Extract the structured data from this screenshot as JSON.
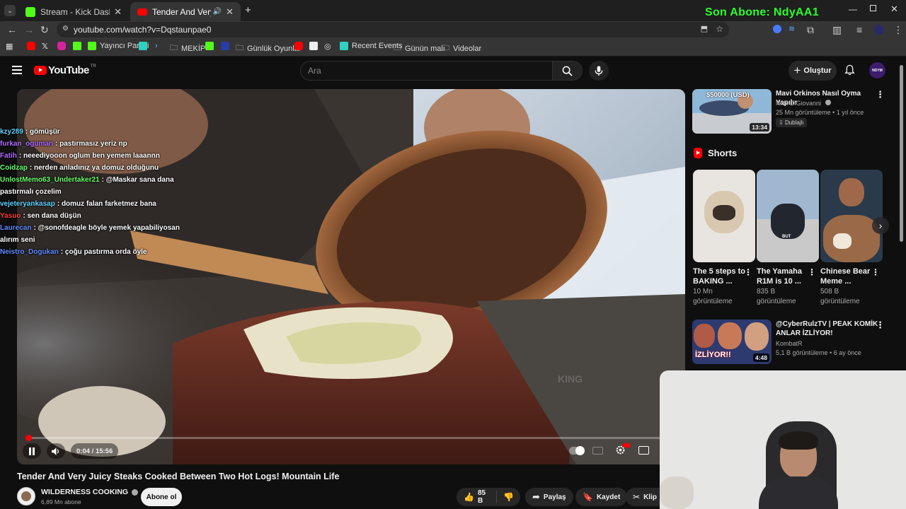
{
  "browser": {
    "tabs": [
      {
        "label": "Stream - Kick Dashboard",
        "active": false
      },
      {
        "label": "Tender And Very Juicy Steak",
        "active": true
      }
    ],
    "url": "youtube.com/watch?v=Dqstaunpae0",
    "overlay_text": "Son Abone: NdyAA1",
    "bookmarks": [
      "Yayıncı Paneli",
      "MEKİP",
      "Günlük Oyunlar",
      "Recent Events",
      "Günün malı",
      "Videolar"
    ]
  },
  "youtube": {
    "logo_text": "YouTube",
    "logo_region": "TR",
    "search_placeholder": "Ara",
    "create_label": "Oluştur",
    "avatar_text": "NDYM"
  },
  "player": {
    "time_current": "0:04",
    "time_total": "15:56",
    "progress": 0.004,
    "watermark": "KING"
  },
  "chat": [
    {
      "user": "kzy289",
      "text": ": gömüşür",
      "color": "#5fd3ff"
    },
    {
      "user": "furkan_oguman",
      "text": ": pastırmasız yeriz np",
      "color": "#b26bff"
    },
    {
      "user": "Fatih",
      "text": ": neeediyooon oglum ben yemem laaannn",
      "color": "#b26bff"
    },
    {
      "user": "Coidzap",
      "text": ": nerden anladınız ya domuz olduğunu",
      "color": "#66ff66"
    },
    {
      "user": "UnlostMemo63_Undertaker21",
      "text": ": @Maskar sana dana pastırmalı çozelim",
      "color": "#66ff66"
    },
    {
      "user": "vejeteryankasap",
      "text": ": domuz falan farketmez bana",
      "color": "#5fd3ff"
    },
    {
      "user": "Yasuo",
      "text": ": sen dana düşün",
      "color": "#ff3b3b"
    },
    {
      "user": "Laurecan",
      "text": ": @sonofdeagle böyle yemek yapabiliyosan alırım seni",
      "color": "#5f8cff"
    },
    {
      "user": "Neistro_Dogukan",
      "text": ": çoğu pastırma orda öyle",
      "color": "#5f8cff"
    }
  ],
  "video": {
    "title": "Tender And Very Juicy Steaks Cooked Between Two Hot Logs! Mountain Life",
    "channel": "WILDERNESS COOKING",
    "subscribers": "6,89 Mn abone",
    "subscribe_label": "Abone ol",
    "likes": "85 B",
    "share_label": "Paylaş",
    "save_label": "Kaydet",
    "clip_label": "Klip"
  },
  "sidebar": {
    "rec1": {
      "title": "Mavi Orkinos Nasıl Oyma Yapılır",
      "channel": "Nick DiGiovanni",
      "meta": "25 Mn görüntüleme • 1 yıl önce",
      "badge": "Dublajlı",
      "duration": "13:34",
      "thumb_text": "$50000 (USD)"
    },
    "shorts_heading": "Shorts",
    "shorts": [
      {
        "title": "The 5 steps to BAKING ...",
        "views": "10 Mn",
        "views2": "görüntüleme"
      },
      {
        "title": "The Yamaha R1M is 10 ...",
        "views": "835 B",
        "views2": "görüntüleme"
      },
      {
        "title": "Chinese Bear Meme ...",
        "views": "508 B",
        "views2": "görüntüleme"
      }
    ],
    "rec2": {
      "title": "@CyberRulzTV | PEAK KOMİK ANLAR İZLİYOR!",
      "channel": "KombatR",
      "meta": "5,1 B görüntüleme • 6 ay önce",
      "duration": "4:48",
      "thumb_text": "İZLİYOR!!"
    }
  }
}
